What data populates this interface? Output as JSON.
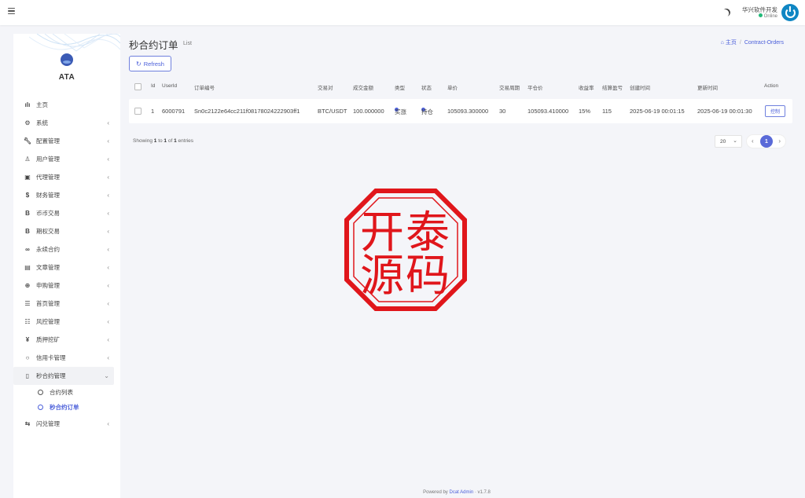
{
  "topbar": {
    "user_name": "华兴软件开发",
    "user_status": "Online"
  },
  "sidebar": {
    "logo_text": "ATA",
    "items": [
      {
        "label": "主页",
        "icon": "bar-chart-icon",
        "has_children": false
      },
      {
        "label": "系统",
        "icon": "gear-icon",
        "has_children": true
      },
      {
        "label": "配置管理",
        "icon": "wrench-icon",
        "has_children": true
      },
      {
        "label": "用户管理",
        "icon": "user-icon",
        "has_children": true
      },
      {
        "label": "代理管理",
        "icon": "id-card-icon",
        "has_children": true
      },
      {
        "label": "财务管理",
        "icon": "dollar-icon",
        "has_children": true
      },
      {
        "label": "币币交易",
        "icon": "bitcoin-icon",
        "has_children": true
      },
      {
        "label": "期权交易",
        "icon": "bitcoin-icon",
        "has_children": true
      },
      {
        "label": "永续合约",
        "icon": "link-icon",
        "has_children": true
      },
      {
        "label": "文章管理",
        "icon": "newspaper-icon",
        "has_children": true
      },
      {
        "label": "申购管理",
        "icon": "globe-icon",
        "has_children": true
      },
      {
        "label": "首页管理",
        "icon": "list-icon",
        "has_children": true
      },
      {
        "label": "风控管理",
        "icon": "list-alt-icon",
        "has_children": true
      },
      {
        "label": "质押挖矿",
        "icon": "yen-icon",
        "has_children": true
      },
      {
        "label": "信用卡管理",
        "icon": "circle-icon",
        "has_children": true
      },
      {
        "label": "秒合约管理",
        "icon": "file-icon",
        "has_children": true,
        "expanded": true
      },
      {
        "label": "闪兑管理",
        "icon": "exchange-icon",
        "has_children": true
      }
    ],
    "submenu": [
      {
        "label": "合约列表",
        "current": false
      },
      {
        "label": "秒合约订单",
        "current": true
      }
    ]
  },
  "content": {
    "title": "秒合约订单",
    "subtitle": "List",
    "breadcrumb_home": "主页",
    "breadcrumb_current": "Contract-Orders",
    "refresh_label": "Refresh"
  },
  "table": {
    "headers": [
      "Id",
      "UserId",
      "订单编号",
      "交易对",
      "成交金额",
      "类型",
      "状态",
      "单价",
      "交易周期",
      "平仓价",
      "收益率",
      "结算盈亏",
      "创建时间",
      "更新时间",
      "Action"
    ],
    "rows": [
      {
        "id": "1",
        "user_id": "6000791",
        "order_no": "Sn0c2122e64cc211f08178024222903ff1",
        "pair": "BTC/USDT",
        "amount": "100.000000",
        "type": "买涨",
        "status": "持仓",
        "price": "105093.300000",
        "period": "30",
        "close_price": "105093.410000",
        "yield": "15%",
        "pnl": "115",
        "created_at": "2025-06-19 00:01:15",
        "updated_at": "2025-06-19 00:01:30",
        "action": "控制"
      }
    ],
    "showing_prefix": "Showing",
    "showing_from": "1",
    "showing_to_word": "to",
    "showing_to": "1",
    "showing_of_word": "of",
    "showing_total": "1",
    "showing_suffix": "entries",
    "page_size": "20",
    "current_page": "1"
  },
  "seal": {
    "chars": [
      "开",
      "泰",
      "源",
      "码"
    ],
    "color": "#e0161b"
  },
  "footer": {
    "prefix": "Powered by",
    "link": "Dcat Admin",
    "separator": "·",
    "version": "v1.7.8"
  }
}
